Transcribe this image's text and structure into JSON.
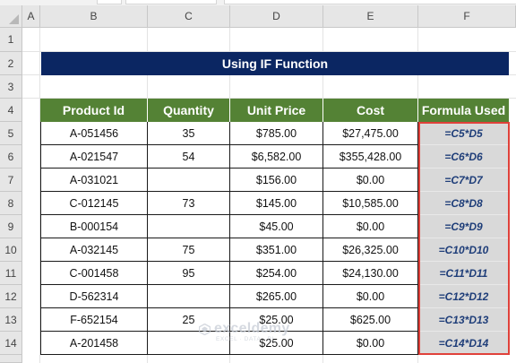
{
  "columns": [
    "A",
    "B",
    "C",
    "D",
    "E",
    "F"
  ],
  "rows": [
    "1",
    "2",
    "3",
    "4",
    "5",
    "6",
    "7",
    "8",
    "9",
    "10",
    "11",
    "12",
    "13",
    "14"
  ],
  "title": "Using IF Function",
  "table": {
    "headers": [
      "Product Id",
      "Quantity",
      "Unit Price",
      "Cost",
      "Formula Used"
    ],
    "rows": [
      [
        "A-051456",
        "35",
        "$785.00",
        "$27,475.00",
        "=C5*D5"
      ],
      [
        "A-021547",
        "54",
        "$6,582.00",
        "$355,428.00",
        "=C6*D6"
      ],
      [
        "A-031021",
        "",
        "$156.00",
        "$0.00",
        "=C7*D7"
      ],
      [
        "C-012145",
        "73",
        "$145.00",
        "$10,585.00",
        "=C8*D8"
      ],
      [
        "B-000154",
        "",
        "$45.00",
        "$0.00",
        "=C9*D9"
      ],
      [
        "A-032145",
        "75",
        "$351.00",
        "$26,325.00",
        "=C10*D10"
      ],
      [
        "C-001458",
        "95",
        "$254.00",
        "$24,130.00",
        "=C11*D11"
      ],
      [
        "D-562314",
        "",
        "$265.00",
        "$0.00",
        "=C12*D12"
      ],
      [
        "F-652154",
        "25",
        "$25.00",
        "$625.00",
        "=C13*D13"
      ],
      [
        "A-201458",
        "",
        "$25.00",
        "$0.00",
        "=C14*D14"
      ]
    ]
  },
  "watermark": {
    "name": "exceldemy",
    "tagline": "EXCEL · DATA · BI"
  },
  "colors": {
    "banner": "#0b2662",
    "header_fill": "#548235",
    "formula_fill": "#d9d9d9",
    "formula_text": "#1f3e79",
    "highlight_border": "#e0413a"
  }
}
